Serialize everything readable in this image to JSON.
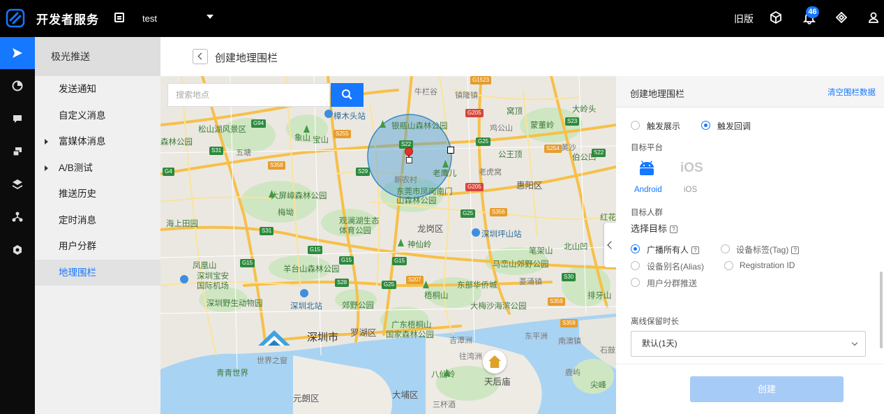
{
  "topbar": {
    "brand": "开发者服务",
    "app_name": "test",
    "old_version": "旧版",
    "notification_count": "46",
    "icons": [
      "logo-icon",
      "app-switch-icon",
      "caret-down-icon",
      "cube-icon",
      "bell-icon",
      "diamond-icon",
      "user-icon"
    ]
  },
  "rail": {
    "items": [
      "send-icon",
      "pie-chart-icon",
      "message-icon",
      "screens-icon",
      "layers-icon",
      "network-icon",
      "settings-icon"
    ]
  },
  "sidenav": {
    "title": "极光推送",
    "items": [
      {
        "label": "发送通知"
      },
      {
        "label": "自定义消息"
      },
      {
        "label": "富媒体消息"
      },
      {
        "label": "A/B测试"
      },
      {
        "label": "推送历史"
      },
      {
        "label": "定时消息"
      },
      {
        "label": "用户分群"
      },
      {
        "label": "地理围栏"
      }
    ]
  },
  "header": {
    "title": "创建地理围栏"
  },
  "map": {
    "search_placeholder": "搜索地点",
    "labels": {
      "l1": "松山湖风景区",
      "l2": "森林公园",
      "l3": "象山",
      "l4": "宝山",
      "l5": "五塘",
      "l6": "樟木头站",
      "l7": "银瓶山森林公园",
      "l8": "新农村",
      "l9": "老鹰儿",
      "l10": "东莞市凤岗南门",
      "l11": "山森林公园",
      "l12": "大屏嶂森林公园",
      "l13": "梅坳",
      "l14": "海上田园",
      "l15": "观澜湖生态",
      "l16": "体育公园",
      "l17": "龙岗区",
      "l18": "深圳坪山站",
      "l19": "神仙岭",
      "l20": "笔架山",
      "l21": "北山凹",
      "l22": "凤凰山",
      "l23": "深圳宝安",
      "l24": "国际机场",
      "l25": "羊台山森林公园",
      "l26": "马峦山郊野公园",
      "l27": "东部华侨城",
      "l28": "梧桐山",
      "l29": "深圳野生动物园",
      "l30": "深圳北站",
      "l31": "郊野公园",
      "l32": "大梅沙海滨公园",
      "l33": "深圳市",
      "l34": "罗湖区",
      "l35": "广东梧桐山",
      "l36": "国家森林公园",
      "l37": "吉潭洲",
      "l38": "往湾洲",
      "l39": "东平洲",
      "l40": "南澳镇",
      "l41": "世界之窗",
      "l42": "青青世界",
      "l43": "八仙岭",
      "l44": "天后庙",
      "l45": "大埔区",
      "l46": "元朗区",
      "l47": "三杯酒",
      "l48": "惠阳区",
      "l49": "大岭头",
      "l50": "窝顶",
      "l51": "蒙董岭",
      "l52": "公王顶",
      "l53": "伯公凹",
      "l54": "红花",
      "l55": "排牙山",
      "l56": "尖峰",
      "l57": "菱涌镇",
      "l58": "牛栏谷",
      "l59": "镇隆镇",
      "l60": "鸡公山",
      "l61": "老虎窝",
      "l62": "黄沙",
      "l63": "鹿屿",
      "l64": "石鼓"
    },
    "shields": {
      "s1": "G94",
      "s2": "S31",
      "s3": "G4",
      "s4": "S255",
      "s5": "S22",
      "s6": "S29",
      "s7": "S358",
      "s8": "G205",
      "s9": "G25",
      "s10": "S254",
      "s11": "S23",
      "s12": "S22",
      "s13": "G205",
      "s14": "G25",
      "s15": "S356",
      "s16": "S31",
      "s17": "G15",
      "s18": "G15",
      "s19": "G15",
      "s20": "G15",
      "s21": "S28",
      "s22": "G25",
      "s23": "S30",
      "s24": "S359",
      "s25": "S359",
      "s26": "G1523",
      "s27": "S207"
    }
  },
  "panel": {
    "title": "创建地理围栏",
    "clear_label": "清空围栏数据",
    "trigger": {
      "option1": "触发展示",
      "option2": "触发回调",
      "selected": "触发回调"
    },
    "platform_label": "目标平台",
    "platforms": {
      "android": "Android",
      "ios": "iOS",
      "ios_logo": "iOS"
    },
    "audience_label": "目标人群",
    "select_target_label": "选择目标",
    "audience_options": {
      "broadcast": "广播所有人",
      "tag": "设备标签(Tag)",
      "alias": "设备别名(Alias)",
      "regid": "Registration ID",
      "segment": "用户分群推送",
      "selected": "广播所有人"
    },
    "offline_label": "离线保留时长",
    "offline_value": "默认(1天)",
    "create_label": "创建"
  },
  "colors": {
    "accent": "#1677ff",
    "topbar": "#000000",
    "create_disabled": "#a6cbf7"
  }
}
